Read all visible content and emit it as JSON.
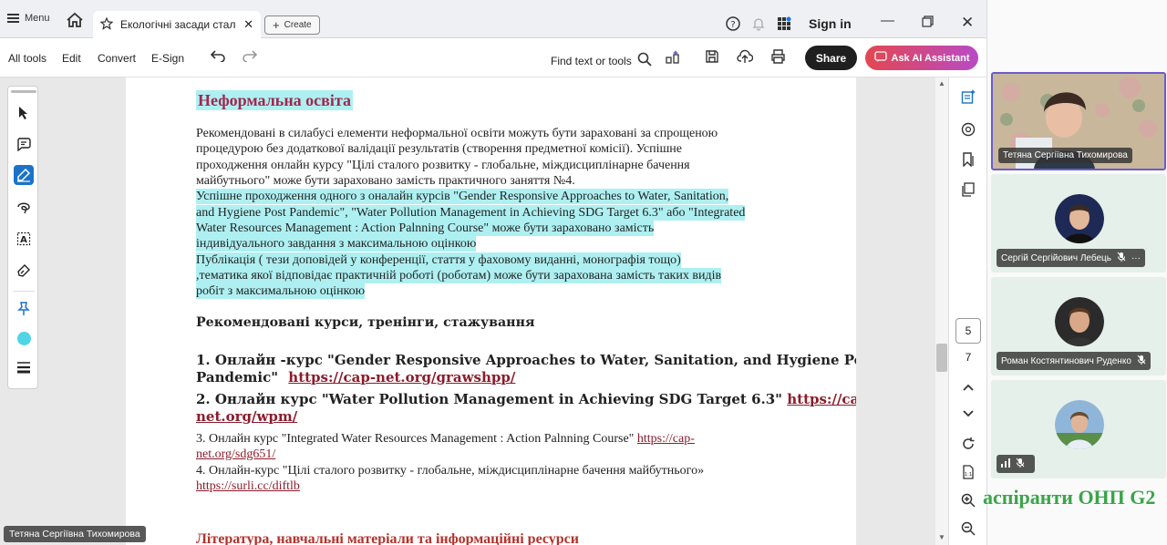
{
  "titlebar": {
    "menu_label": "Menu",
    "tab_title": "Екологічні засади стал...",
    "create_label": "Create",
    "signin_label": "Sign in"
  },
  "toolbar": {
    "all_tools": "All tools",
    "edit": "Edit",
    "convert": "Convert",
    "esign": "E-Sign",
    "find_placeholder": "Find text or tools",
    "share_label": "Share",
    "ai_label": "Ask AI Assistant"
  },
  "document": {
    "heading": "Неформальна освіта",
    "para_lines": [
      "Рекомендовані в силабусі елементи неформальної освіти можуть бути зараховані за спрощеною",
      "процедурою без додаткової валідації результатів (створення предметної комісії). Успішне",
      "проходження онлайн курсу \"Цілі сталого розвитку - глобальне, міждисциплінарне бачення",
      "майбутнього\" може бути зараховано замість практичного заняття №4."
    ],
    "hl_lines": [
      "Успішне проходження одного з оналайн курсів \"Gender Responsive Approaches to Water, Sanitation,",
      "and Hygiene Post Pandemic\", \"Water Pollution Management in Achieving SDG Target 6.3\" або \"Integrated",
      "Water Resources Management : Action Palnning Course\" може бути зараховано замість",
      "індивідуального завдання з максимальною оцінкою",
      "Публікація ( тези доповідей у конференції, стаття у фаховому виданні, монографія тощо)",
      ",тематика якої відповідає практичній роботі (роботам) може бути зарахована замість  таких видів",
      "робіт з максимальною оцінкою"
    ],
    "courses_heading": "Рекомендовані курси, тренінги, стажування",
    "course1_a": "1. Онлайн -курс  \"Gender Responsive Approaches to Water, Sanitation, and Hygiene Post",
    "course1_b": "Pandemic\"",
    "course1_link": "https://cap-net.org/grawshpp/",
    "course2_a": "2. Онлайн курс \"Water Pollution Management in Achieving SDG Target 6.3\"",
    "course2_link_a": "https://cap-",
    "course2_link_b": "net.org/wpm/",
    "course3_a": "3. Онлайн курс \"Integrated Water Resources Management : Action Palnning Course\"",
    "course3_link_a": "https://cap-",
    "course3_link_b": "net.org/sdg651/",
    "course4_a": "4. Онлайн-курс \"Цілі сталого розвитку - глобальне, міждисциплінарне бачення майбутнього»",
    "course4_link": "https://surli.cc/diftlb",
    "literature_heading": "Література, навчальні матеріали та інформаційні ресурси"
  },
  "right_rail": {
    "page_current": "5",
    "page_total": "7"
  },
  "participants": [
    {
      "name": "Тетяна Сергіївна Тихомирова"
    },
    {
      "name": "Сергій Сергійович Лебець"
    },
    {
      "name": "Роман Костянтинович Руденко"
    },
    {
      "name": ""
    }
  ],
  "group_label": "аспіранти ОНП G2",
  "bottom_speaker": "Тетяна Сергіївна Тихомирова"
}
